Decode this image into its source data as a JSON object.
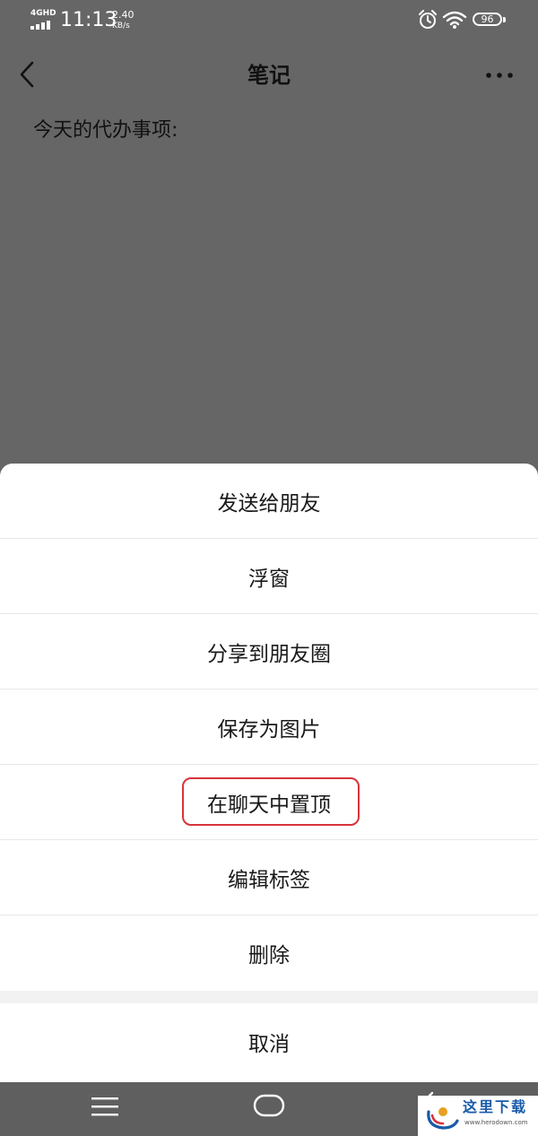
{
  "status_bar": {
    "network": "4GHD",
    "time": "11:13",
    "speed_value": "2.40",
    "speed_unit": "KB/s",
    "battery": "96",
    "icons": [
      "signal-icon",
      "alarm-icon",
      "wifi-icon",
      "battery-icon"
    ]
  },
  "header": {
    "title": "笔记",
    "back_icon": "chevron-left-icon",
    "more_icon": "more-dots-icon"
  },
  "note": {
    "content": "今天的代办事项:"
  },
  "action_sheet": {
    "items": [
      {
        "label": "发送给朋友"
      },
      {
        "label": "浮窗"
      },
      {
        "label": "分享到朋友圈"
      },
      {
        "label": "保存为图片"
      },
      {
        "label": "在聊天中置顶",
        "highlighted": true
      },
      {
        "label": "编辑标签"
      },
      {
        "label": "删除"
      }
    ],
    "cancel_label": "取消",
    "highlight_color": "#d8333a"
  },
  "nav_bar": {
    "icons": [
      "menu-icon",
      "home-icon",
      "back-icon"
    ]
  },
  "watermark": {
    "title": "这里下载",
    "url": "www.herodown.com"
  },
  "colors": {
    "overlay": "#666666",
    "sheet_bg": "#ffffff",
    "nav_bg": "#5f5f5f"
  }
}
